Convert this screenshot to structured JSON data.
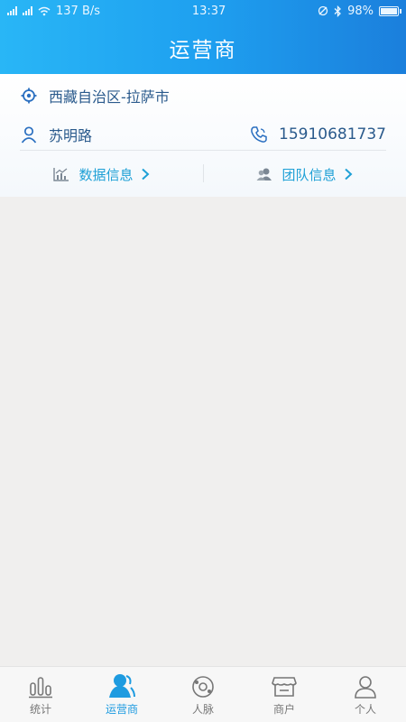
{
  "status_bar": {
    "net_speed": "137 B/s",
    "time": "13:37",
    "battery": "98%",
    "battery_level": 0.98
  },
  "header": {
    "title": "运营商"
  },
  "info": {
    "location": "西藏自治区-拉萨市",
    "contact_name": "苏明路",
    "phone": "15910681737"
  },
  "links": [
    {
      "label": "数据信息",
      "icon": "chart-icon"
    },
    {
      "label": "团队信息",
      "icon": "team-icon"
    }
  ],
  "tabs": [
    {
      "label": "统计",
      "icon": "bar-chart-icon"
    },
    {
      "label": "运营商",
      "icon": "operator-icon",
      "active": true
    },
    {
      "label": "人脉",
      "icon": "network-icon"
    },
    {
      "label": "商户",
      "icon": "store-icon"
    },
    {
      "label": "个人",
      "icon": "person-icon"
    }
  ],
  "colors": {
    "accent": "#1e9be0",
    "text_primary": "#2a5a8c",
    "background": "#f0efee"
  }
}
